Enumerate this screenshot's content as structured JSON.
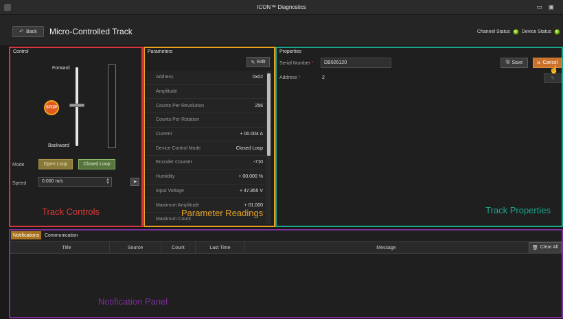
{
  "window": {
    "title": "ICON™ Diagnostics",
    "controls": "▭ ▣"
  },
  "header": {
    "back_label": "Back",
    "page_title": "Micro-Controlled Track",
    "channel_status_label": "Channel Status",
    "device_status_label": "Device Status"
  },
  "control": {
    "heading": "Control",
    "forward_label": "Forward",
    "backward_label": "Backward",
    "stop_label": "STOP",
    "mode_label": "Mode",
    "mode_open_label": "Open Loop",
    "mode_closed_label": "Closed Loop",
    "speed_label": "Speed",
    "speed_value": "0.000 m/s",
    "caption": "Track Controls"
  },
  "parameters": {
    "heading": "Parameters",
    "edit_label": "Edit",
    "rows": [
      {
        "key": "Address",
        "value": "0x02"
      },
      {
        "key": "Amplitude",
        "value": ""
      },
      {
        "key": "Counts Per Revolution",
        "value": "256"
      },
      {
        "key": "Counts Per Rotation",
        "value": ""
      },
      {
        "key": "Current",
        "value": "+ 00.004 A"
      },
      {
        "key": "Device Control Mode",
        "value": "Closed Loop"
      },
      {
        "key": "Encoder Counter",
        "value": "-710"
      },
      {
        "key": "Humidity",
        "value": "+ 00.000 %"
      },
      {
        "key": "Input Voltage",
        "value": "+ 47.855 V"
      },
      {
        "key": "Maximum Amplitude",
        "value": "+ 01.000"
      },
      {
        "key": "Maximum Count",
        "value": ""
      }
    ],
    "caption": "Parameter Readings"
  },
  "properties": {
    "heading": "Properties",
    "serial_label": "Serial Number",
    "serial_value": "DB026120",
    "address_label": "Address",
    "address_value": "2",
    "required_mark": "*",
    "save_label": "Save",
    "cancel_label": "Cancel",
    "caption": "Track Properties"
  },
  "notifications": {
    "tabs": [
      "Notifications",
      "Communication"
    ],
    "columns": [
      "Title",
      "Source",
      "Count",
      "Last Time",
      "Message"
    ],
    "clear_label": "Clear All",
    "caption": "Notification Panel"
  },
  "colors": {
    "control_border": "#d8353f",
    "params_border": "#e7a224",
    "props_border": "#1da48d",
    "notif_border": "#7b2f98",
    "status_led": "#6cb21a"
  }
}
